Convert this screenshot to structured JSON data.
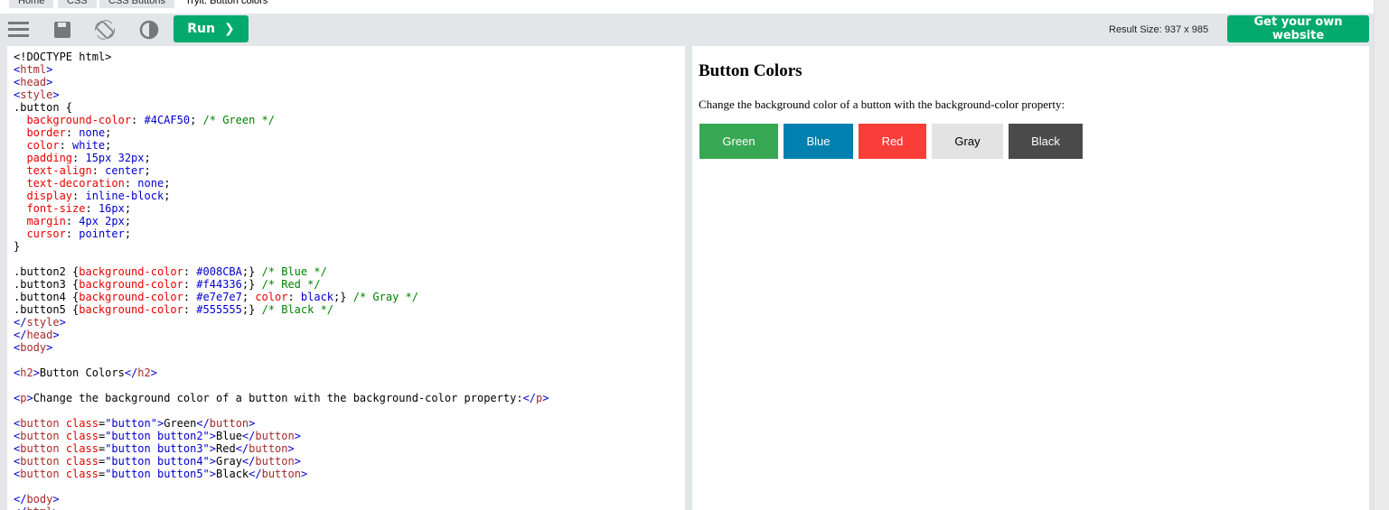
{
  "breadcrumb": [
    "Home",
    "CSS",
    "CSS Buttons",
    "Tryit: Button colors"
  ],
  "toolbar": {
    "run_label": "Run",
    "result_size": "Result Size: 937 x 985",
    "get_website_label": "Get your own website",
    "icons": [
      "menu-icon",
      "save-icon",
      "rotate-icon",
      "contrast-icon"
    ]
  },
  "colors": {
    "accent": "#04aa6d"
  },
  "code": [
    [
      [
        "s",
        "<!DOCTYPE html>"
      ]
    ],
    [
      [
        "t",
        "<"
      ],
      [
        "n",
        "html"
      ],
      [
        "t",
        ">"
      ]
    ],
    [
      [
        "t",
        "<"
      ],
      [
        "n",
        "head"
      ],
      [
        "t",
        ">"
      ]
    ],
    [
      [
        "t",
        "<"
      ],
      [
        "n",
        "style"
      ],
      [
        "t",
        ">"
      ]
    ],
    [
      [
        "s",
        ".button {"
      ]
    ],
    [
      [
        "s",
        "  "
      ],
      [
        "p",
        "background-color"
      ],
      [
        "s",
        ": "
      ],
      [
        "v",
        "#4CAF50"
      ],
      [
        "s",
        "; "
      ],
      [
        "c",
        "/* Green */"
      ]
    ],
    [
      [
        "s",
        "  "
      ],
      [
        "p",
        "border"
      ],
      [
        "s",
        ": "
      ],
      [
        "v",
        "none"
      ],
      [
        "s",
        ";"
      ]
    ],
    [
      [
        "s",
        "  "
      ],
      [
        "p",
        "color"
      ],
      [
        "s",
        ": "
      ],
      [
        "v",
        "white"
      ],
      [
        "s",
        ";"
      ]
    ],
    [
      [
        "s",
        "  "
      ],
      [
        "p",
        "padding"
      ],
      [
        "s",
        ": "
      ],
      [
        "v",
        "15px 32px"
      ],
      [
        "s",
        ";"
      ]
    ],
    [
      [
        "s",
        "  "
      ],
      [
        "p",
        "text-align"
      ],
      [
        "s",
        ": "
      ],
      [
        "v",
        "center"
      ],
      [
        "s",
        ";"
      ]
    ],
    [
      [
        "s",
        "  "
      ],
      [
        "p",
        "text-decoration"
      ],
      [
        "s",
        ": "
      ],
      [
        "v",
        "none"
      ],
      [
        "s",
        ";"
      ]
    ],
    [
      [
        "s",
        "  "
      ],
      [
        "p",
        "display"
      ],
      [
        "s",
        ": "
      ],
      [
        "v",
        "inline-block"
      ],
      [
        "s",
        ";"
      ]
    ],
    [
      [
        "s",
        "  "
      ],
      [
        "p",
        "font-size"
      ],
      [
        "s",
        ": "
      ],
      [
        "v",
        "16px"
      ],
      [
        "s",
        ";"
      ]
    ],
    [
      [
        "s",
        "  "
      ],
      [
        "p",
        "margin"
      ],
      [
        "s",
        ": "
      ],
      [
        "v",
        "4px 2px"
      ],
      [
        "s",
        ";"
      ]
    ],
    [
      [
        "s",
        "  "
      ],
      [
        "p",
        "cursor"
      ],
      [
        "s",
        ": "
      ],
      [
        "v",
        "pointer"
      ],
      [
        "s",
        ";"
      ]
    ],
    [
      [
        "s",
        "}"
      ]
    ],
    [
      [
        "s",
        ""
      ]
    ],
    [
      [
        "s",
        ".button2 {"
      ],
      [
        "p",
        "background-color"
      ],
      [
        "s",
        ": "
      ],
      [
        "v",
        "#008CBA"
      ],
      [
        "s",
        ";} "
      ],
      [
        "c",
        "/* Blue */"
      ]
    ],
    [
      [
        "s",
        ".button3 {"
      ],
      [
        "p",
        "background-color"
      ],
      [
        "s",
        ": "
      ],
      [
        "v",
        "#f44336"
      ],
      [
        "s",
        ";} "
      ],
      [
        "c",
        "/* Red */"
      ]
    ],
    [
      [
        "s",
        ".button4 {"
      ],
      [
        "p",
        "background-color"
      ],
      [
        "s",
        ": "
      ],
      [
        "v",
        "#e7e7e7"
      ],
      [
        "s",
        "; "
      ],
      [
        "p",
        "color"
      ],
      [
        "s",
        ": "
      ],
      [
        "v",
        "black"
      ],
      [
        "s",
        ";} "
      ],
      [
        "c",
        "/* Gray */"
      ]
    ],
    [
      [
        "s",
        ".button5 {"
      ],
      [
        "p",
        "background-color"
      ],
      [
        "s",
        ": "
      ],
      [
        "v",
        "#555555"
      ],
      [
        "s",
        ";} "
      ],
      [
        "c",
        "/* Black */"
      ]
    ],
    [
      [
        "t",
        "</"
      ],
      [
        "n",
        "style"
      ],
      [
        "t",
        ">"
      ]
    ],
    [
      [
        "t",
        "</"
      ],
      [
        "n",
        "head"
      ],
      [
        "t",
        ">"
      ]
    ],
    [
      [
        "t",
        "<"
      ],
      [
        "n",
        "body"
      ],
      [
        "t",
        ">"
      ]
    ],
    [
      [
        "s",
        ""
      ]
    ],
    [
      [
        "t",
        "<"
      ],
      [
        "n",
        "h2"
      ],
      [
        "t",
        ">"
      ],
      [
        "s",
        "Button Colors"
      ],
      [
        "t",
        "</"
      ],
      [
        "n",
        "h2"
      ],
      [
        "t",
        ">"
      ]
    ],
    [
      [
        "s",
        ""
      ]
    ],
    [
      [
        "t",
        "<"
      ],
      [
        "n",
        "p"
      ],
      [
        "t",
        ">"
      ],
      [
        "s",
        "Change the background color of a button with the background-color property:"
      ],
      [
        "t",
        "</"
      ],
      [
        "n",
        "p"
      ],
      [
        "t",
        ">"
      ]
    ],
    [
      [
        "s",
        ""
      ]
    ],
    [
      [
        "t",
        "<"
      ],
      [
        "n",
        "button"
      ],
      [
        "a",
        " class"
      ],
      [
        "s",
        "="
      ],
      [
        "v",
        "\"button\""
      ],
      [
        "t",
        ">"
      ],
      [
        "s",
        "Green"
      ],
      [
        "t",
        "</"
      ],
      [
        "n",
        "button"
      ],
      [
        "t",
        ">"
      ]
    ],
    [
      [
        "t",
        "<"
      ],
      [
        "n",
        "button"
      ],
      [
        "a",
        " class"
      ],
      [
        "s",
        "="
      ],
      [
        "v",
        "\"button button2\""
      ],
      [
        "t",
        ">"
      ],
      [
        "s",
        "Blue"
      ],
      [
        "t",
        "</"
      ],
      [
        "n",
        "button"
      ],
      [
        "t",
        ">"
      ]
    ],
    [
      [
        "t",
        "<"
      ],
      [
        "n",
        "button"
      ],
      [
        "a",
        " class"
      ],
      [
        "s",
        "="
      ],
      [
        "v",
        "\"button button3\""
      ],
      [
        "t",
        ">"
      ],
      [
        "s",
        "Red"
      ],
      [
        "t",
        "</"
      ],
      [
        "n",
        "button"
      ],
      [
        "t",
        ">"
      ]
    ],
    [
      [
        "t",
        "<"
      ],
      [
        "n",
        "button"
      ],
      [
        "a",
        " class"
      ],
      [
        "s",
        "="
      ],
      [
        "v",
        "\"button button4\""
      ],
      [
        "t",
        ">"
      ],
      [
        "s",
        "Gray"
      ],
      [
        "t",
        "</"
      ],
      [
        "n",
        "button"
      ],
      [
        "t",
        ">"
      ]
    ],
    [
      [
        "t",
        "<"
      ],
      [
        "n",
        "button"
      ],
      [
        "a",
        " class"
      ],
      [
        "s",
        "="
      ],
      [
        "v",
        "\"button button5\""
      ],
      [
        "t",
        ">"
      ],
      [
        "s",
        "Black"
      ],
      [
        "t",
        "</"
      ],
      [
        "n",
        "button"
      ],
      [
        "t",
        ">"
      ]
    ],
    [
      [
        "s",
        ""
      ]
    ],
    [
      [
        "t",
        "</"
      ],
      [
        "n",
        "body"
      ],
      [
        "t",
        ">"
      ]
    ],
    [
      [
        "t",
        "</"
      ],
      [
        "n",
        "html"
      ],
      [
        "t",
        ">"
      ]
    ]
  ],
  "result": {
    "heading": "Button Colors",
    "paragraph": "Change the background color of a button with the background-color property:",
    "buttons": [
      {
        "label": "Green",
        "bg": "#38a753",
        "fg": "#ffffff"
      },
      {
        "label": "Blue",
        "bg": "#0080ae",
        "fg": "#ffffff"
      },
      {
        "label": "Red",
        "bg": "#f93e3a",
        "fg": "#ffffff"
      },
      {
        "label": "Gray",
        "bg": "#e3e3e3",
        "fg": "#000000"
      },
      {
        "label": "Black",
        "bg": "#4a4a4a",
        "fg": "#ffffff"
      }
    ]
  }
}
